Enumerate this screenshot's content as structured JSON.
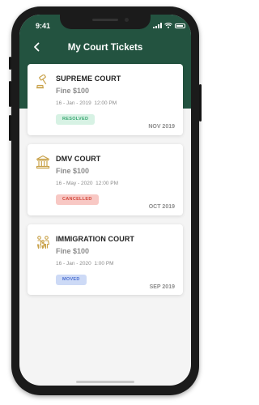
{
  "status_bar": {
    "time": "9:41"
  },
  "header": {
    "title": "My Court Tickets"
  },
  "colors": {
    "header_bg": "#235340",
    "accent_gold": "#c9a24a",
    "resolved_bg": "#d7f2e4",
    "resolved_fg": "#3aa873",
    "cancelled_bg": "#f8c8c4",
    "cancelled_fg": "#d2463a",
    "moved_bg": "#cddaf6",
    "moved_fg": "#4b6fd1"
  },
  "tickets": [
    {
      "icon": "gavel-icon",
      "court": "SUPREME COURT",
      "fine": "Fine $100",
      "date": "16 - Jan - 2019",
      "time": "12:00 PM",
      "status": "RESOLVED",
      "month": "NOV 2019"
    },
    {
      "icon": "courthouse-icon",
      "court": "DMV COURT",
      "fine": "Fine $100",
      "date": "16 - May - 2020",
      "time": "12:00 PM",
      "status": "CANCELLED",
      "month": "OCT 2019"
    },
    {
      "icon": "family-icon",
      "court": "IMMIGRATION COURT",
      "fine": "Fine $100",
      "date": "16 - Jan - 2020",
      "time": "1:00 PM",
      "status": "MOVED",
      "month": "SEP 2019"
    }
  ]
}
